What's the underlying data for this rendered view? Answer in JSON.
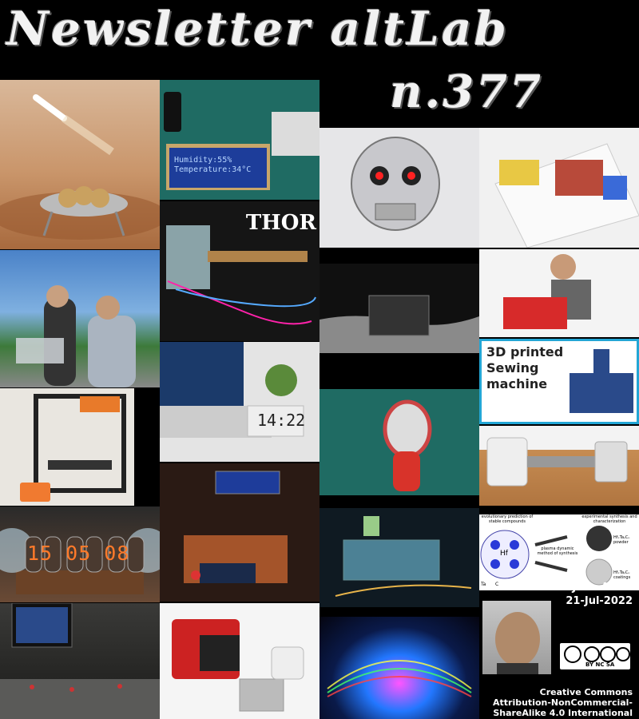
{
  "header": {
    "title": "Newsletter altLab",
    "issue": "n.377"
  },
  "tiles": {
    "lcd_text": "Humidity:55% Temperature:34°C",
    "thor": "THOR",
    "clock": "14:22",
    "nixie": "15 05 08",
    "sewing": "3D printed Sewing machine",
    "chem_1": "evolutionary prediction of stable compounds",
    "chem_2": "experimental synthesis and characterization",
    "chem_3": "plasma dynamic method of synthesis",
    "chem_4": "HfₓTaᵧCᵤ powder",
    "chem_5": "HfₓTaᵧCᵤ coatings",
    "chem_hf": "Hf",
    "chem_ta": "Ta",
    "chem_c": "C"
  },
  "credits": {
    "author": "João Alves",
    "date": "21-Jul-2022",
    "cc_label": "BY NC SA",
    "license": "Creative Commons Attribution-NonCommercial-ShareAlike 4.0 International"
  }
}
